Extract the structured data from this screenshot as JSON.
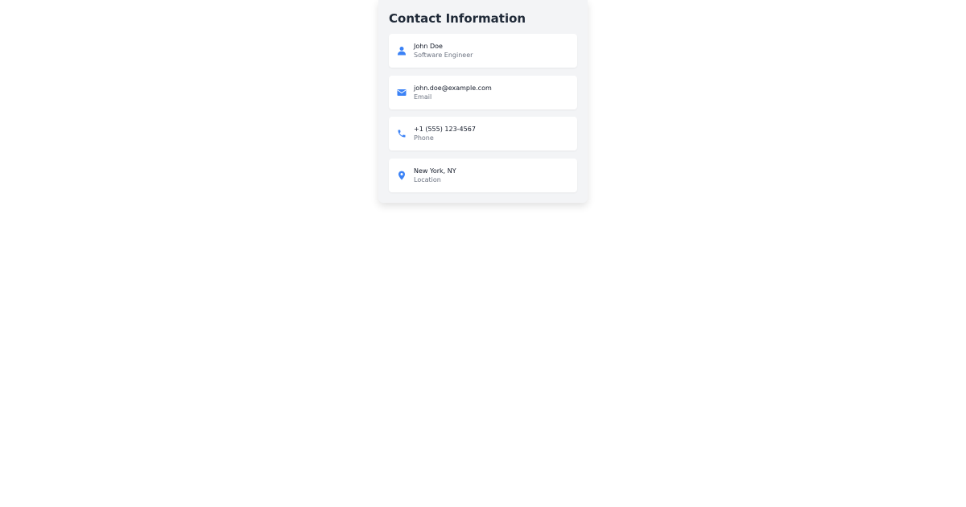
{
  "card": {
    "title": "Contact Information"
  },
  "colors": {
    "accent": "#3b82f6",
    "card_bg": "#f3f4f6",
    "item_bg": "#ffffff",
    "primary_text": "#111827",
    "secondary_text": "#6b7280"
  },
  "contacts": [
    {
      "icon": "user-icon",
      "primary": "John Doe",
      "secondary": "Software Engineer"
    },
    {
      "icon": "envelope-icon",
      "primary": "john.doe@example.com",
      "secondary": "Email"
    },
    {
      "icon": "phone-icon",
      "primary": "+1 (555) 123-4567",
      "secondary": "Phone"
    },
    {
      "icon": "location-pin-icon",
      "primary": "New York, NY",
      "secondary": "Location"
    }
  ]
}
